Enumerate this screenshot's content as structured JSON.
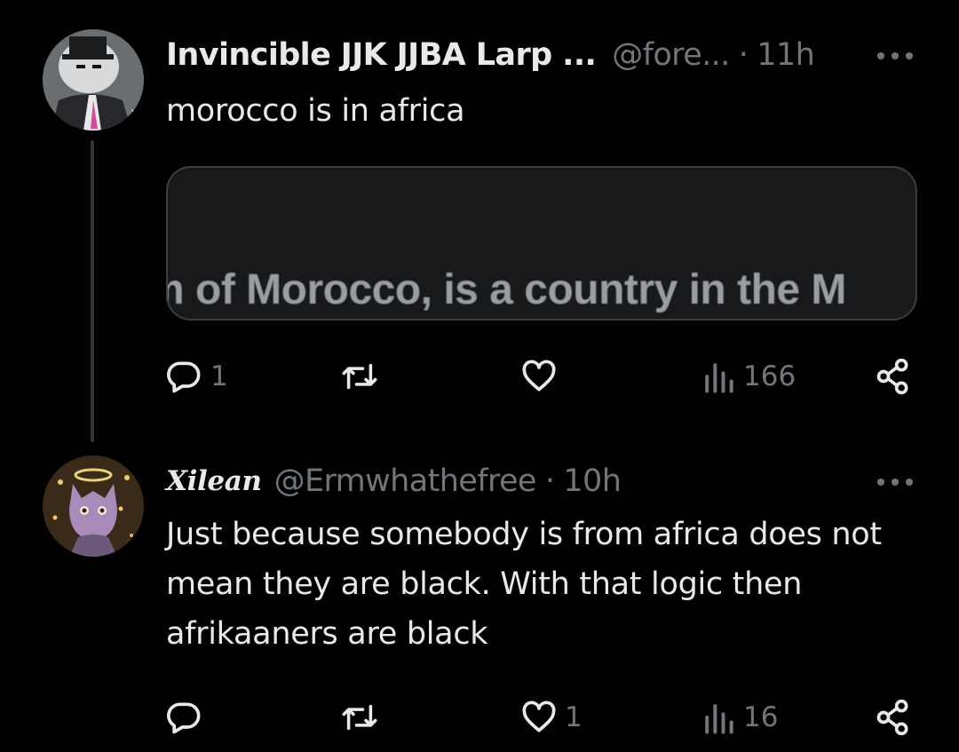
{
  "posts": [
    {
      "display_name": "Invincible JJK JJBA Larp ...",
      "handle": "@fore...",
      "separator": "·",
      "time": "11h",
      "text": "morocco is in africa",
      "media_text": "m of Morocco, is a country in the M",
      "replies": "1",
      "reposts": "",
      "likes": "",
      "views": "166"
    },
    {
      "display_name": "Xilean",
      "handle": "@Ermwhathefree",
      "separator": "·",
      "time": "10h",
      "text": "Just because somebody is from africa does not mean they are black. With that logic then afrikaaners are black",
      "replies": "",
      "reposts": "",
      "likes": "1",
      "views": "16"
    }
  ],
  "icons": {
    "more": "more-horizontal-icon",
    "reply": "reply-bubble-icon",
    "repost": "repost-icon",
    "like": "heart-icon",
    "views": "views-bar-chart-icon",
    "share": "share-icon"
  },
  "colors": {
    "background": "#000000",
    "text": "#e7e9ea",
    "muted": "#71767b",
    "border": "#333639"
  }
}
